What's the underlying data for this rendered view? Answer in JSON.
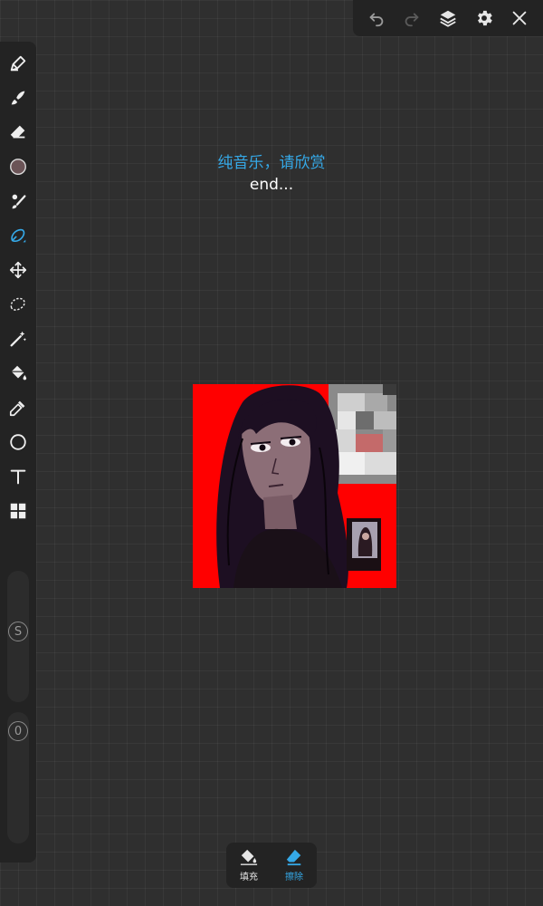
{
  "topbar": {
    "buttons": [
      {
        "name": "undo",
        "icon": "undo-icon"
      },
      {
        "name": "redo",
        "icon": "redo-icon"
      },
      {
        "name": "layers",
        "icon": "layers-icon"
      },
      {
        "name": "settings",
        "icon": "gear-icon"
      },
      {
        "name": "close",
        "icon": "close-icon"
      }
    ]
  },
  "toolbar": {
    "tools": [
      "pen-icon",
      "smudge-icon",
      "eraser-icon",
      "color-swatch",
      "brush-icon",
      "lasso-fill-icon",
      "move-icon",
      "lasso-select-icon",
      "magic-wand-icon",
      "fill-bucket-icon",
      "eyedropper-icon",
      "shape-circle-icon",
      "text-icon",
      "grid-icon"
    ],
    "active_tool": "lasso-fill-icon",
    "current_color": "#6b5457",
    "size_label": "S",
    "opacity_label": "0"
  },
  "canvas": {
    "title": "纯音乐，请欣赏",
    "subtitle": "end..."
  },
  "bottom_panel": {
    "fill_label": "填充",
    "erase_label": "擦除",
    "active": "erase"
  },
  "colors": {
    "accent": "#35a9e8",
    "panel": "#232323",
    "background": "#2f2f2f"
  }
}
